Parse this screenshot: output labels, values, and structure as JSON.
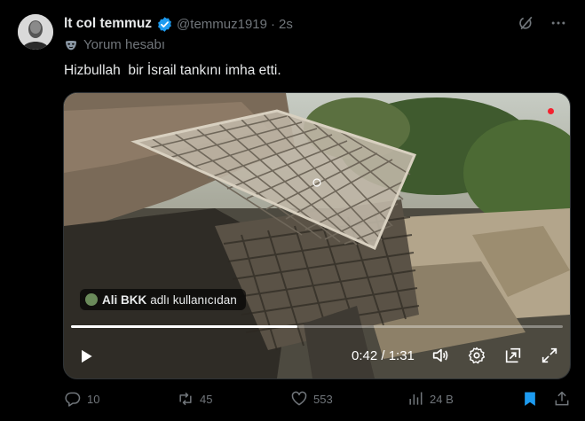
{
  "tweet": {
    "author_name": "lt col temmuz",
    "handle": "@temmuz1919",
    "separator": "·",
    "time": "2s",
    "account_label": "Yorum hesabı",
    "text": "Hizbullah  bir İsrail tankını imha etti."
  },
  "video": {
    "attribution_user": "Ali BKK",
    "attribution_suffix": "adlı kullanıcıdan",
    "current_time": "0:42",
    "duration": "1:31",
    "time_display": "0:42 / 1:31",
    "progress_fraction": 0.46
  },
  "actions": {
    "replies": "10",
    "reposts": "45",
    "likes": "553",
    "views": "24 B"
  },
  "colors": {
    "background": "#000000",
    "text": "#e7e9ea",
    "muted": "#71767b",
    "verified": "#1d9bf0",
    "bookmark_active": "#1d9bf0"
  },
  "icons": {
    "verified": "verified-badge-icon",
    "grok": "grok-icon",
    "more": "more-icon",
    "account": "mask-icon",
    "play": "play-icon",
    "volume": "volume-icon",
    "settings": "settings-icon",
    "pip": "pip-icon",
    "fullscreen": "fullscreen-icon",
    "reply": "reply-icon",
    "repost": "repost-icon",
    "like": "like-icon",
    "views": "views-icon",
    "bookmark": "bookmark-icon",
    "share": "share-icon"
  }
}
